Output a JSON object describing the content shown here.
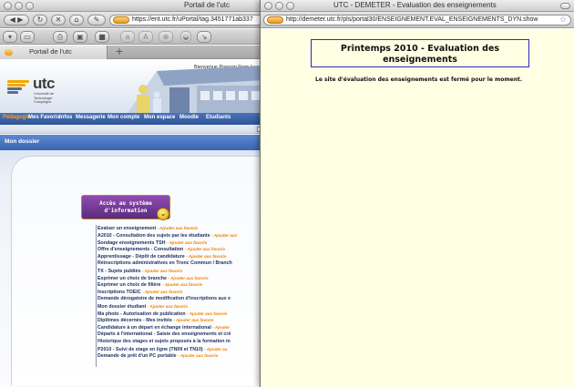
{
  "back_window": {
    "title": "Portail de l'utc",
    "url": "https://ent.utc.fr/uPortal/tag.3451771ab337",
    "tab_label": "Portail de l'utc",
    "welcome_text": "Bienvenue Prenom Nom",
    "welcome_accent": "Acc",
    "logo_word": "utc",
    "logo_sub": "Université de Technologie Compiègne",
    "menu": [
      "Pédagogie",
      "Mes Favoris",
      "Infos",
      "Messagerie",
      "Mon compte",
      "Mon espace",
      "Moodle",
      "Etudiants"
    ],
    "section_title": "Mon dossier",
    "acces_title_line1": "Accès au système",
    "acces_title_line2": "d'information",
    "fav_suffix": "- Ajouter aux favoris",
    "links": [
      {
        "label": "Evaluer un enseignement",
        "fav": "- Ajouter aux favoris"
      },
      {
        "label": "A2010 - Consultation des sujets par les étudiants",
        "fav": "- Ajouter aux"
      },
      {
        "label": "Sondage enseignements TSH",
        "fav": "- Ajouter aux favoris"
      },
      {
        "label": "Offre d'enseignements - Consultation",
        "fav": "- Ajouter aux favoris"
      },
      {
        "label": "Apprentissage - Dépôt de candidature",
        "fav": "- Ajouter aux favoris"
      },
      {
        "label": "Réinscriptions administratives en Tronc Commun / Branch",
        "fav": ""
      },
      {
        "label": "TX - Sujets publiés",
        "fav": "- Ajouter aux favoris"
      },
      {
        "label": "Exprimer un choix de branche",
        "fav": "- Ajouter aux favoris"
      },
      {
        "label": "Exprimer un choix de filière",
        "fav": "- Ajouter aux favoris"
      },
      {
        "label": "Inscriptions TOEIC",
        "fav": "- Ajouter aux favoris"
      },
      {
        "label": "Demande dérogatoire de modification d'inscriptions aux e",
        "fav": ""
      },
      {
        "label": "Mon dossier étudiant",
        "fav": "- Ajouter aux favoris"
      },
      {
        "label": "Ma photo - Autorisation de publication",
        "fav": "- Ajouter aux favoris"
      },
      {
        "label": "Diplômes décernés - Mes invités",
        "fav": "- Ajouter aux favoris"
      },
      {
        "label": "Candidature à un départ en échange international",
        "fav": "- Ajouter"
      },
      {
        "label": "Départs à l'international - Saisie des enseignements et cré",
        "fav": ""
      },
      {
        "label": "Historique des stages et sujets proposés à la formation in",
        "fav": ""
      },
      {
        "label": "P2010 - Suivi de stage en ligne (TN09 et TN10)",
        "fav": "- Ajouter au"
      },
      {
        "label": "Demande de prêt d'un PC portable",
        "fav": "- Ajouter aux favoris"
      }
    ]
  },
  "front_window": {
    "title": "UTC - DEMETER - Evaluation des enseignements",
    "url": "http://demeter.utc.fr/pls/portal30/ENSEIGNEMENT.EVAL_ENSEIGNEMENTS_DYN.show",
    "heading_line1": "Printemps 2010 - Evaluation des",
    "heading_line2": "enseignements",
    "message": "Le site d'évaluation des enseignements est fermé pour le moment."
  },
  "icons": {
    "back": "back-arrow-icon",
    "forward": "forward-arrow-icon",
    "reload": "reload-icon",
    "home": "home-icon",
    "bookmark_star": "star-icon",
    "acces_toggle": "chevron-down-icon"
  },
  "colors": {
    "menu_bg": "#2f5597",
    "menu_active": "#ff9d1a",
    "section_bg": "#3a65b0",
    "link_text": "#1d2f5e",
    "fav_text": "#f07f00",
    "doc_bg": "#ffffe4",
    "heading_border": "#2b2bb7",
    "acces_bg": "#6a3392"
  }
}
